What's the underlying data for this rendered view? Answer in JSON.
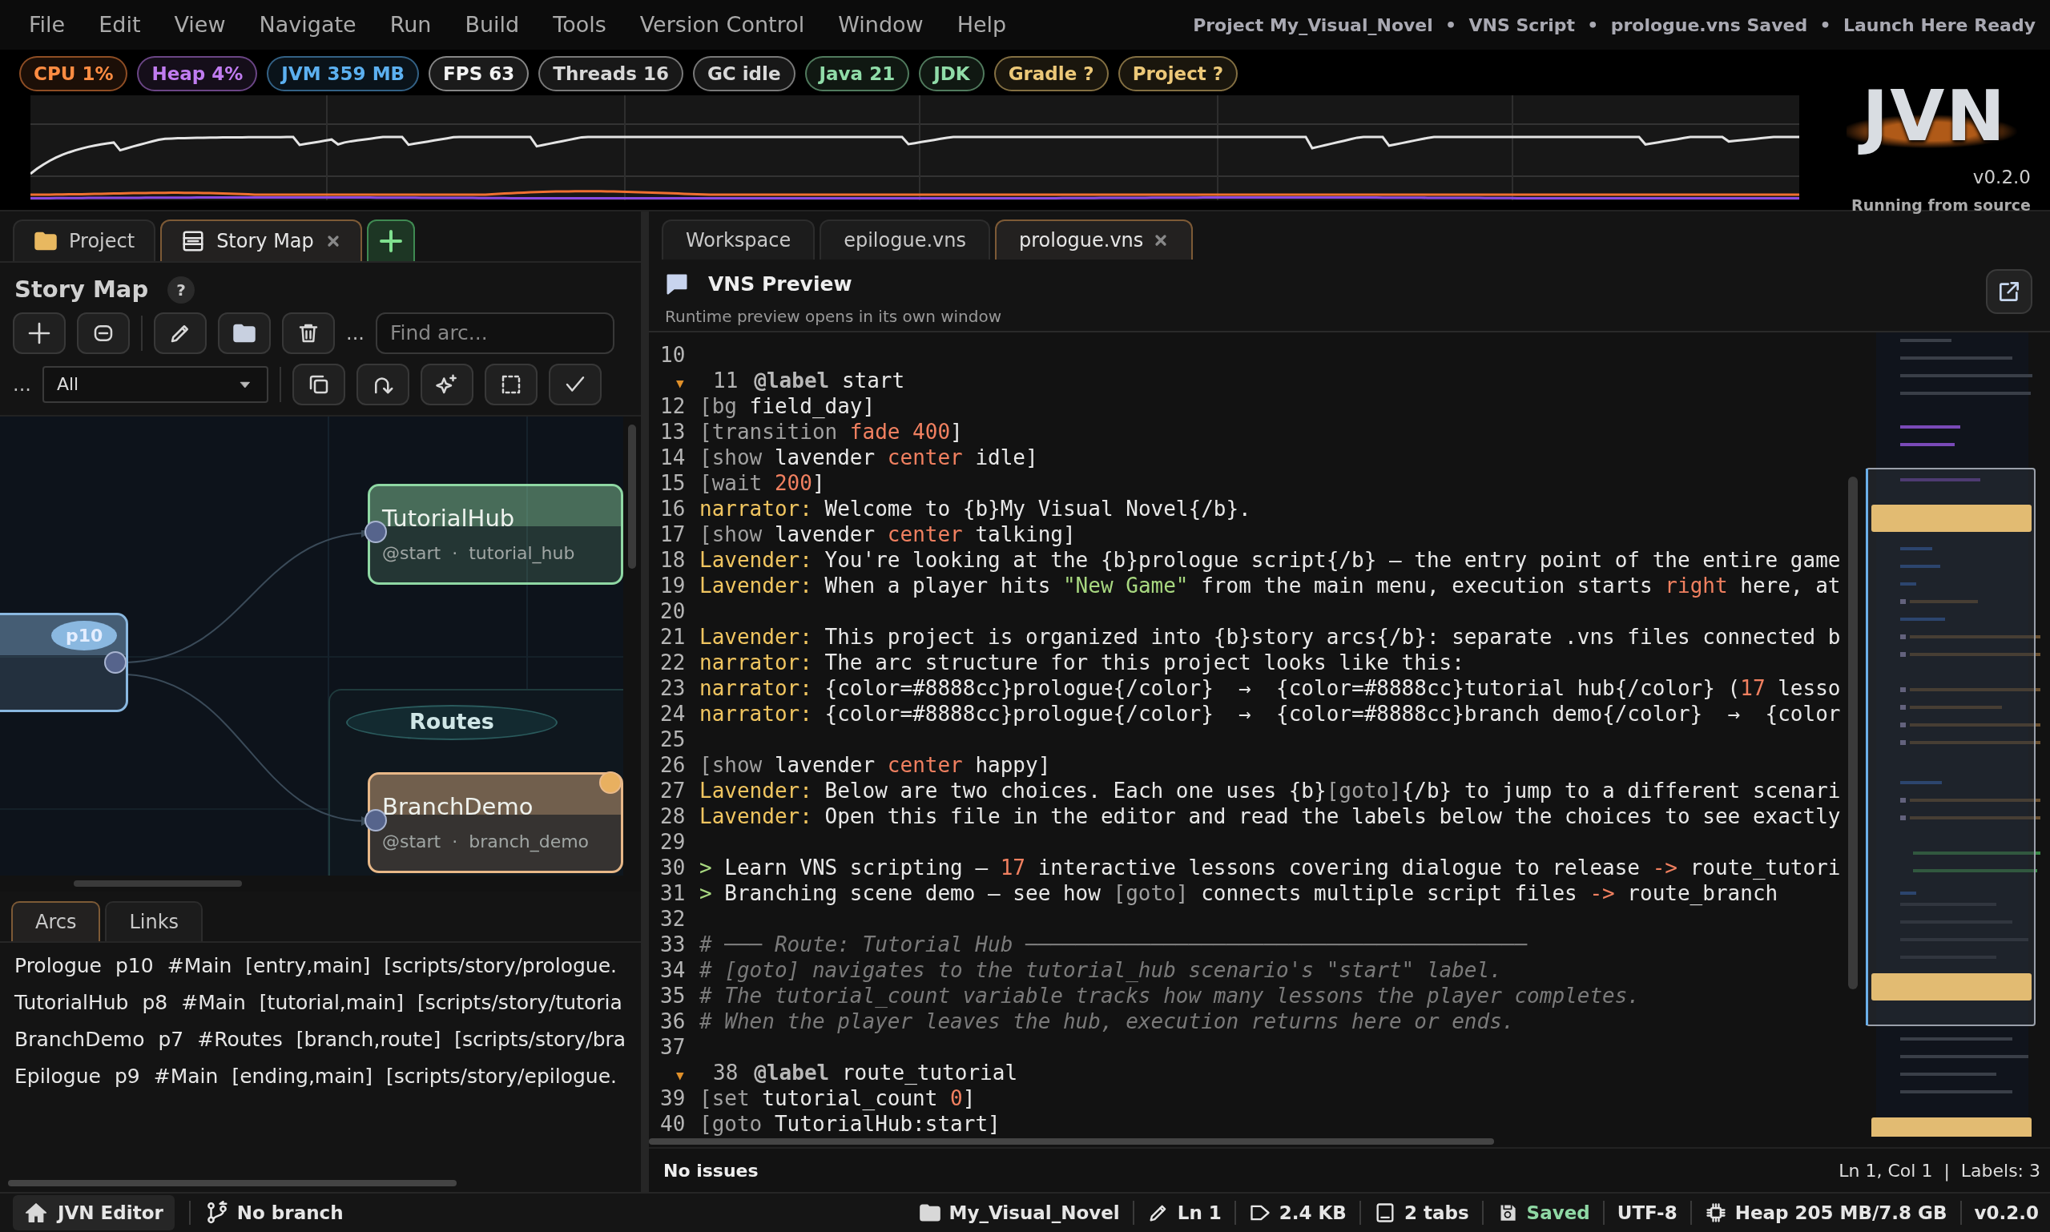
{
  "menu": [
    "File",
    "Edit",
    "View",
    "Navigate",
    "Run",
    "Build",
    "Tools",
    "Version Control",
    "Window",
    "Help"
  ],
  "title_status": "Project My_Visual_Novel  •  VNS Script  •  prologue.vns Saved  •  Launch Here Ready",
  "badges": [
    {
      "label": "CPU 1%",
      "color": "#ff8c42"
    },
    {
      "label": "Heap 4%",
      "color": "#c07cf0"
    },
    {
      "label": "JVM 359 MB",
      "color": "#5cb0f0"
    },
    {
      "label": "FPS 63",
      "color": "#f2f2f2"
    },
    {
      "label": "Threads 16",
      "color": "#d8d8d8"
    },
    {
      "label": "GC idle",
      "color": "#d8d8d8"
    },
    {
      "label": "Java 21",
      "color": "#90dca8"
    },
    {
      "label": "JDK",
      "color": "#90dca8"
    },
    {
      "label": "Gradle ?",
      "color": "#ecc878"
    },
    {
      "label": "Project ?",
      "color": "#ecc878"
    }
  ],
  "logo": {
    "text": "JVN",
    "version": "v0.2.0",
    "subtitle": "Running from source"
  },
  "left_panel": {
    "tabs": [
      {
        "label": "Project",
        "kind": "folder",
        "selected": false,
        "closable": false
      },
      {
        "label": "Story Map",
        "kind": "map",
        "selected": true,
        "closable": true
      }
    ],
    "title": "Story Map",
    "help": "?",
    "toolbar_more": "...",
    "search": {
      "placeholder": "Find arc..."
    },
    "filter_more": "...",
    "filter": {
      "value": "All"
    },
    "canvas": {
      "nodes": [
        {
          "badge": "p10",
          "color": "#8ab8e0"
        },
        {
          "title": "TutorialHub",
          "subtitle": "@start  ·  tutorial_hub",
          "color": "#8fd8a4"
        },
        {
          "title": "BranchDemo",
          "subtitle": "@start  ·  branch_demo",
          "color": "#e8b888"
        }
      ],
      "groups": [
        {
          "label": "Routes"
        }
      ]
    },
    "bottom_tabs": [
      {
        "label": "Arcs",
        "selected": true
      },
      {
        "label": "Links",
        "selected": false
      }
    ],
    "arcs": [
      {
        "name": "Prologue",
        "page": "p10",
        "group": "#Main",
        "tags": "[entry,main]",
        "path": "[scripts/story/prologue."
      },
      {
        "name": "TutorialHub",
        "page": "p8",
        "group": "#Main",
        "tags": "[tutorial,main]",
        "path": "[scripts/story/tutoria"
      },
      {
        "name": "BranchDemo",
        "page": "p7",
        "group": "#Routes",
        "tags": "[branch,route]",
        "path": "[scripts/story/bra"
      },
      {
        "name": "Epilogue",
        "page": "p9",
        "group": "#Main",
        "tags": "[ending,main]",
        "path": "[scripts/story/epilogue."
      }
    ]
  },
  "editor": {
    "tabs": [
      {
        "label": "Workspace",
        "selected": false,
        "closable": false
      },
      {
        "label": "epilogue.vns",
        "selected": false,
        "closable": false
      },
      {
        "label": "prologue.vns",
        "selected": true,
        "closable": true
      }
    ],
    "preview": {
      "title": "VNS Preview",
      "subtitle": "Runtime preview opens in its own window"
    },
    "fold_glyph": "▼",
    "lines": [
      {
        "n": "10",
        "fold": false
      },
      {
        "n": "11",
        "fold": true,
        "tokens": [
          {
            "kind": "label",
            "text": "@label"
          },
          {
            "kind": "plain",
            "text": " start"
          }
        ]
      },
      {
        "n": "12",
        "fold": false,
        "tokens": [
          {
            "kind": "command",
            "text": "[bg"
          },
          {
            "kind": "plain",
            "text": " field_day]"
          }
        ]
      },
      {
        "n": "13",
        "fold": false,
        "tokens": [
          {
            "kind": "command",
            "text": "[transition "
          },
          {
            "kind": "value",
            "text": "fade 400"
          },
          {
            "kind": "plain",
            "text": "]"
          }
        ]
      },
      {
        "n": "14",
        "fold": false,
        "tokens": [
          {
            "kind": "command",
            "text": "[show"
          },
          {
            "kind": "plain",
            "text": " lavender "
          },
          {
            "kind": "value",
            "text": "center"
          },
          {
            "kind": "plain",
            "text": " idle]"
          }
        ]
      },
      {
        "n": "15",
        "fold": false,
        "tokens": [
          {
            "kind": "command",
            "text": "[wait "
          },
          {
            "kind": "value",
            "text": "200"
          },
          {
            "kind": "plain",
            "text": "]"
          }
        ]
      },
      {
        "n": "16",
        "fold": false,
        "tokens": [
          {
            "kind": "speaker",
            "text": "narrator:"
          },
          {
            "kind": "plain",
            "text": " Welcome to {b}My Visual Novel{/b}."
          }
        ]
      },
      {
        "n": "17",
        "fold": false,
        "tokens": [
          {
            "kind": "command",
            "text": "[show"
          },
          {
            "kind": "plain",
            "text": " lavender "
          },
          {
            "kind": "value",
            "text": "center"
          },
          {
            "kind": "plain",
            "text": " talking]"
          }
        ]
      },
      {
        "n": "18",
        "fold": false,
        "tokens": [
          {
            "kind": "speaker",
            "text": "Lavender:"
          },
          {
            "kind": "plain",
            "text": " You're looking at the {b}prologue script{/b} — the entry point of the entire game"
          }
        ]
      },
      {
        "n": "19",
        "fold": false,
        "tokens": [
          {
            "kind": "speaker",
            "text": "Lavender:"
          },
          {
            "kind": "plain",
            "text": " When a player hits "
          },
          {
            "kind": "string",
            "text": "\"New Game\""
          },
          {
            "kind": "plain",
            "text": " from the main menu, execution starts "
          },
          {
            "kind": "value",
            "text": "right"
          },
          {
            "kind": "plain",
            "text": " here, at"
          }
        ]
      },
      {
        "n": "20",
        "fold": false
      },
      {
        "n": "21",
        "fold": false,
        "tokens": [
          {
            "kind": "speaker",
            "text": "Lavender:"
          },
          {
            "kind": "plain",
            "text": " This project is organized into {b}story arcs{/b}: separate .vns files connected b"
          }
        ]
      },
      {
        "n": "22",
        "fold": false,
        "tokens": [
          {
            "kind": "speaker",
            "text": "narrator:"
          },
          {
            "kind": "plain",
            "text": " The arc structure for this project looks like this:"
          }
        ]
      },
      {
        "n": "23",
        "fold": false,
        "tokens": [
          {
            "kind": "speaker",
            "text": "narrator:"
          },
          {
            "kind": "plain",
            "text": " {color=#8888cc}prologue{/color}  →  {color=#8888cc}tutorial hub{/color} ("
          },
          {
            "kind": "value",
            "text": "17"
          },
          {
            "kind": "plain",
            "text": " lesso"
          }
        ]
      },
      {
        "n": "24",
        "fold": false,
        "tokens": [
          {
            "kind": "speaker",
            "text": "narrator:"
          },
          {
            "kind": "plain",
            "text": " {color=#8888cc}prologue{/color}  →  {color=#8888cc}branch demo{/color}  →  {color"
          }
        ]
      },
      {
        "n": "25",
        "fold": false
      },
      {
        "n": "26",
        "fold": false,
        "tokens": [
          {
            "kind": "command",
            "text": "[show"
          },
          {
            "kind": "plain",
            "text": " lavender "
          },
          {
            "kind": "value",
            "text": "center"
          },
          {
            "kind": "plain",
            "text": " happy]"
          }
        ]
      },
      {
        "n": "27",
        "fold": false,
        "tokens": [
          {
            "kind": "speaker",
            "text": "Lavender:"
          },
          {
            "kind": "plain",
            "text": " Below are two choices. Each one uses {b}"
          },
          {
            "kind": "command",
            "text": "[goto]"
          },
          {
            "kind": "plain",
            "text": "{/b} to jump to a different scenari"
          }
        ]
      },
      {
        "n": "28",
        "fold": false,
        "tokens": [
          {
            "kind": "speaker",
            "text": "Lavender:"
          },
          {
            "kind": "plain",
            "text": " Open this file in the editor and read the labels below the choices to see exactly"
          }
        ]
      },
      {
        "n": "29",
        "fold": false
      },
      {
        "n": "30",
        "fold": false,
        "tokens": [
          {
            "kind": "choice",
            "text": ">"
          },
          {
            "kind": "plain",
            "text": " Learn VNS scripting — "
          },
          {
            "kind": "value",
            "text": "17"
          },
          {
            "kind": "plain",
            "text": " interactive lessons covering dialogue to release "
          },
          {
            "kind": "value",
            "text": "->"
          },
          {
            "kind": "plain",
            "text": " route_tutori"
          }
        ]
      },
      {
        "n": "31",
        "fold": false,
        "tokens": [
          {
            "kind": "choice",
            "text": ">"
          },
          {
            "kind": "plain",
            "text": " Branching scene demo — see how "
          },
          {
            "kind": "command",
            "text": "[goto]"
          },
          {
            "kind": "plain",
            "text": " connects multiple script files "
          },
          {
            "kind": "value",
            "text": "->"
          },
          {
            "kind": "plain",
            "text": " route_branch"
          }
        ]
      },
      {
        "n": "32",
        "fold": false
      },
      {
        "n": "33",
        "fold": false,
        "tokens": [
          {
            "kind": "comment",
            "text": "# ─── Route: Tutorial Hub ────────────────────────────────────────"
          }
        ]
      },
      {
        "n": "34",
        "fold": false,
        "tokens": [
          {
            "kind": "comment",
            "text": "# [goto] navigates to the tutorial_hub scenario's \"start\" label."
          }
        ]
      },
      {
        "n": "35",
        "fold": false,
        "tokens": [
          {
            "kind": "comment",
            "text": "# The tutorial_count variable tracks how many lessons the player completes."
          }
        ]
      },
      {
        "n": "36",
        "fold": false,
        "tokens": [
          {
            "kind": "comment",
            "text": "# When the player leaves the hub, execution returns here or ends."
          }
        ]
      },
      {
        "n": "37",
        "fold": false
      },
      {
        "n": "38",
        "fold": true,
        "tokens": [
          {
            "kind": "label",
            "text": "@label"
          },
          {
            "kind": "plain",
            "text": " route_tutorial"
          }
        ]
      },
      {
        "n": "39",
        "fold": false,
        "tokens": [
          {
            "kind": "command",
            "text": "[set"
          },
          {
            "kind": "plain",
            "text": " tutorial_count "
          },
          {
            "kind": "value",
            "text": "0"
          },
          {
            "kind": "plain",
            "text": "]"
          }
        ]
      },
      {
        "n": "40",
        "fold": false,
        "tokens": [
          {
            "kind": "command",
            "text": "[goto"
          },
          {
            "kind": "plain",
            "text": " TutorialHub:start]"
          }
        ]
      }
    ],
    "footer": {
      "issues": "No issues",
      "position": "Ln 1, Col 1  |  Labels: 3"
    }
  },
  "status_bar": {
    "left": [
      {
        "kind": "home",
        "label": "JVN Editor"
      },
      {
        "kind": "branch",
        "label": "No branch"
      }
    ],
    "right": [
      {
        "kind": "folder",
        "label": "My_Visual_Novel",
        "color": "#e6e6e6"
      },
      {
        "kind": "pencil",
        "label": "Ln 1",
        "color": "#e6e6e6"
      },
      {
        "kind": "tag",
        "label": "2.4 KB",
        "color": "#e6e6e6"
      },
      {
        "kind": "window",
        "label": "2 tabs",
        "color": "#e6e6e6"
      },
      {
        "kind": "save",
        "label": "Saved",
        "color": "#8fd8a4"
      },
      {
        "kind": "text",
        "label": "UTF-8",
        "color": "#e6e6e6"
      },
      {
        "kind": "chip",
        "label": "Heap 205 MB/7.8 GB",
        "color": "#e6e6e6"
      },
      {
        "kind": "text",
        "label": "v0.2.0",
        "color": "#e6e6e6"
      }
    ]
  }
}
